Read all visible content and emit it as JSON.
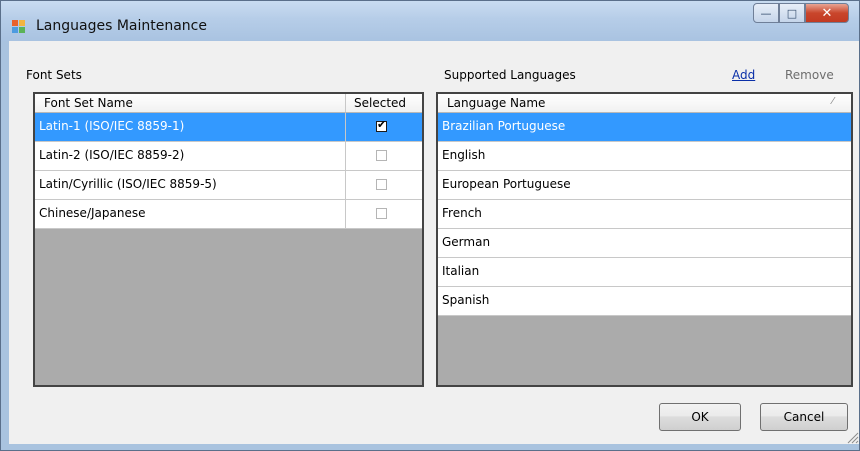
{
  "window": {
    "title": "Languages Maintenance"
  },
  "font_sets": {
    "label": "Font Sets",
    "columns": [
      "Font Set Name",
      "Selected"
    ],
    "rows": [
      {
        "name": "Latin-1 (ISO/IEC 8859-1)",
        "selected": true,
        "highlighted": true
      },
      {
        "name": "Latin-2 (ISO/IEC 8859-2)",
        "selected": false,
        "highlighted": false
      },
      {
        "name": "Latin/Cyrillic (ISO/IEC 8859-5)",
        "selected": false,
        "highlighted": false
      },
      {
        "name": "Chinese/Japanese",
        "selected": false,
        "highlighted": false
      }
    ]
  },
  "languages": {
    "label": "Supported Languages",
    "add_label": "Add",
    "remove_label": "Remove",
    "column": "Language Name",
    "rows": [
      {
        "name": "Brazilian Portuguese",
        "highlighted": true
      },
      {
        "name": "English",
        "highlighted": false
      },
      {
        "name": "European Portuguese",
        "highlighted": false
      },
      {
        "name": "French",
        "highlighted": false
      },
      {
        "name": "German",
        "highlighted": false
      },
      {
        "name": "Italian",
        "highlighted": false
      },
      {
        "name": "Spanish",
        "highlighted": false
      }
    ]
  },
  "buttons": {
    "ok_label": "OK",
    "cancel_label": "Cancel"
  },
  "colors": {
    "selection": "#3399ff",
    "link": "#0a2fa8",
    "grid_empty": "#ababab"
  }
}
